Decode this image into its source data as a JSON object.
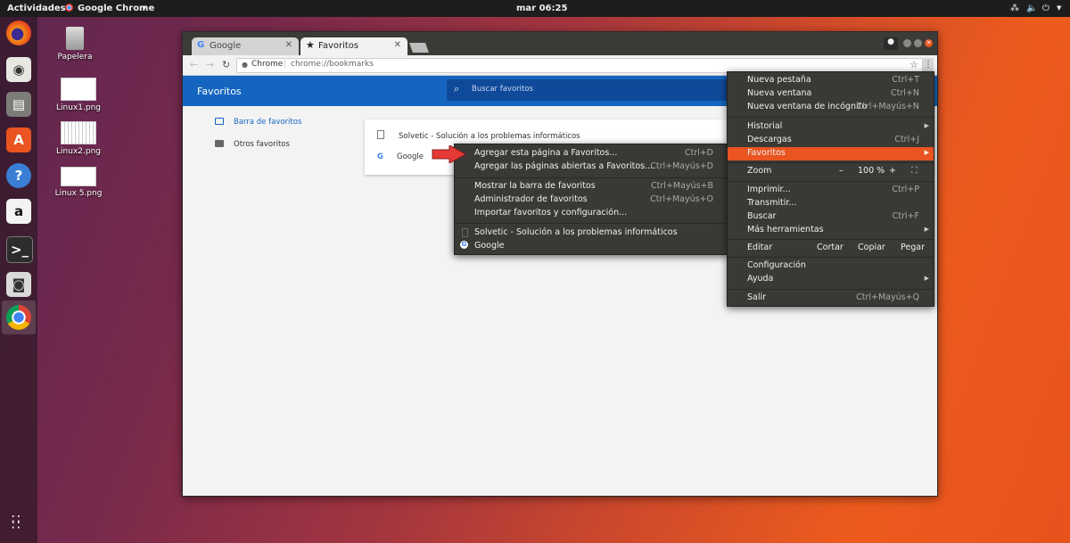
{
  "topbar": {
    "activities": "Actividades",
    "app": "Google Chrome",
    "clock": "mar 06:25"
  },
  "desktop": {
    "icons": [
      "Papelera",
      "Linux1.png",
      "Linux2.png",
      "Linux 5.png"
    ]
  },
  "browser": {
    "tabs": [
      {
        "label": "Google"
      },
      {
        "label": "Favoritos"
      }
    ],
    "address": {
      "site": "Chrome",
      "url": "chrome://bookmarks"
    },
    "header": {
      "title": "Favoritos",
      "search_placeholder": "Buscar favoritos"
    },
    "sidebar": [
      {
        "label": "Barra de favoritos",
        "selected": true
      },
      {
        "label": "Otros favoritos",
        "selected": false
      }
    ],
    "bookmarks": [
      "Solvetic - Solución a los problemas informáticos",
      "Google"
    ]
  },
  "main_menu": {
    "items": [
      {
        "label": "Nueva pestaña",
        "shortcut": "Ctrl+T"
      },
      {
        "label": "Nueva ventana",
        "shortcut": "Ctrl+N"
      },
      {
        "label": "Nueva ventana de incógnito",
        "shortcut": "Ctrl+Mayús+N"
      },
      {
        "label": "Historial",
        "shortcut": ""
      },
      {
        "label": "Descargas",
        "shortcut": "Ctrl+J"
      },
      {
        "label": "Favoritos",
        "shortcut": ""
      },
      {
        "label": "Zoom",
        "shortcut": ""
      },
      {
        "label": "Imprimir...",
        "shortcut": "Ctrl+P"
      },
      {
        "label": "Transmitir...",
        "shortcut": ""
      },
      {
        "label": "Buscar",
        "shortcut": "Ctrl+F"
      },
      {
        "label": "Más herramientas",
        "shortcut": ""
      },
      {
        "label": "Editar",
        "shortcut": ""
      },
      {
        "label": "Configuración",
        "shortcut": ""
      },
      {
        "label": "Ayuda",
        "shortcut": ""
      },
      {
        "label": "Salir",
        "shortcut": "Ctrl+Mayús+Q"
      }
    ],
    "zoom": {
      "minus": "–",
      "value": "100 %",
      "plus": "+"
    },
    "edit": {
      "cut": "Cortar",
      "copy": "Copiar",
      "paste": "Pegar"
    }
  },
  "favorites_menu": {
    "items": [
      {
        "label": "Agregar esta página a Favoritos...",
        "shortcut": "Ctrl+D"
      },
      {
        "label": "Agregar las páginas abiertas a Favoritos...",
        "shortcut": "Ctrl+Mayús+D"
      },
      {
        "label": "Mostrar la barra de favoritos",
        "shortcut": "Ctrl+Mayús+B"
      },
      {
        "label": "Administrador de favoritos",
        "shortcut": "Ctrl+Mayús+O"
      },
      {
        "label": "Importar favoritos y configuración...",
        "shortcut": ""
      },
      {
        "label": "Solvetic - Solución a los problemas informáticos",
        "shortcut": ""
      },
      {
        "label": "Google",
        "shortcut": ""
      }
    ]
  },
  "colors": {
    "ubuntu_orange": "#e95420",
    "chrome_blue": "#1565c0"
  }
}
